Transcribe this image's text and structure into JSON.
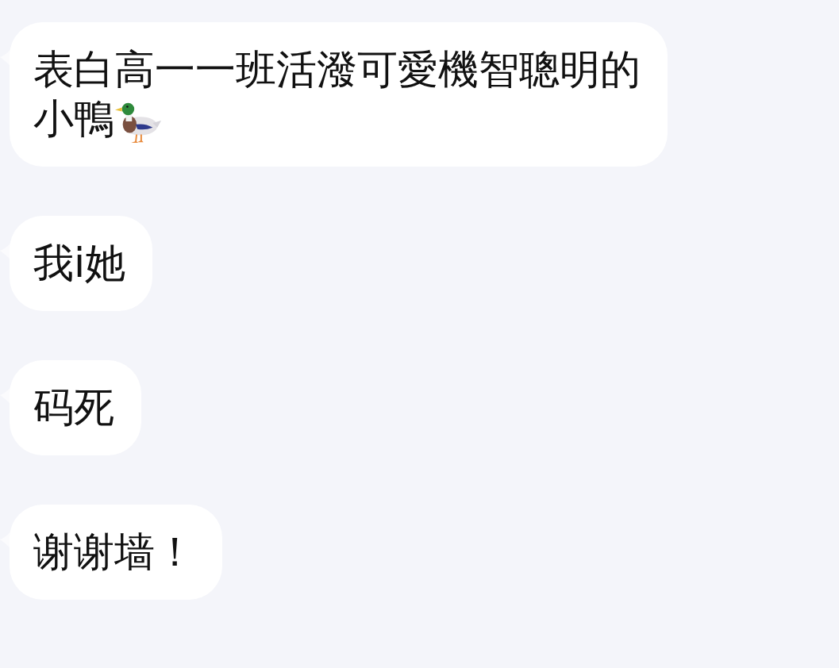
{
  "messages": [
    {
      "kind": "text_with_icon",
      "lines": [
        "表白高一一班活潑可愛機智聰明的",
        "小鴨"
      ]
    },
    {
      "kind": "text",
      "lines": [
        "我i她"
      ]
    },
    {
      "kind": "text",
      "lines": [
        "码死"
      ]
    },
    {
      "kind": "text",
      "lines": [
        "谢谢墙！"
      ]
    }
  ]
}
